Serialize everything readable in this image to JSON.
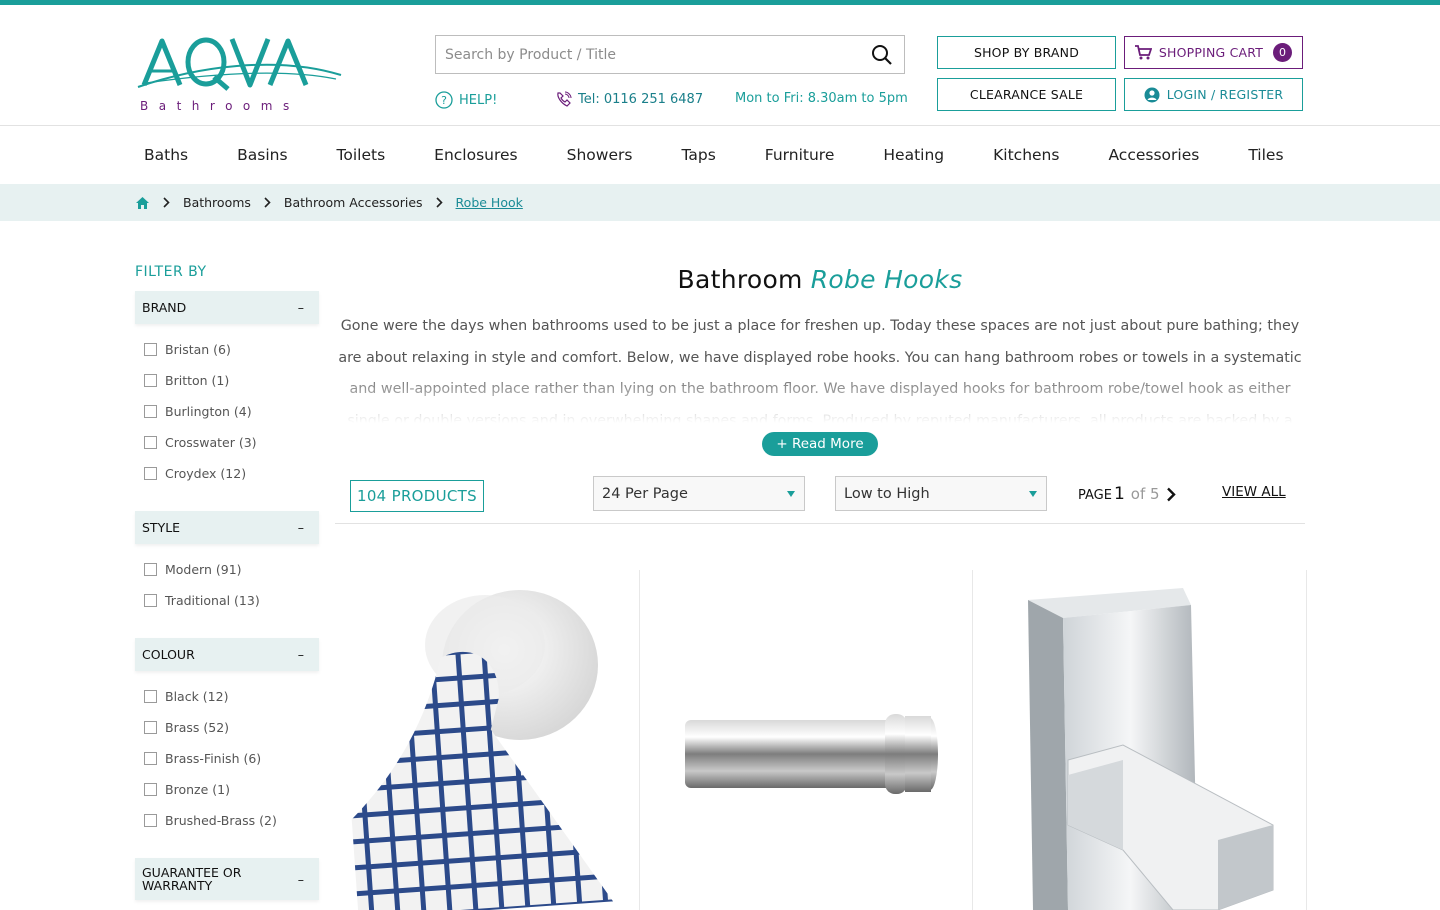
{
  "brand": {
    "name": "AQVA",
    "tagline": "Bathrooms"
  },
  "search": {
    "placeholder": "Search by Product / Title"
  },
  "contact": {
    "help": "HELP!",
    "tel": "Tel: 0116 251 6487",
    "hours": "Mon to Fri: 8.30am to 5pm"
  },
  "header_buttons": {
    "shop_by_brand": "SHOP BY BRAND",
    "shopping_cart": "SHOPPING CART",
    "cart_count": "0",
    "clearance_sale": "CLEARANCE SALE",
    "login": "LOGIN / REGISTER"
  },
  "nav": [
    "Baths",
    "Basins",
    "Toilets",
    "Enclosures",
    "Showers",
    "Taps",
    "Furniture",
    "Heating",
    "Kitchens",
    "Accessories",
    "Tiles"
  ],
  "breadcrumb": [
    "Bathrooms",
    "Bathroom Accessories",
    "Robe Hook"
  ],
  "filters": {
    "title": "FILTER BY",
    "groups": [
      {
        "name": "BRAND",
        "toggle": "–",
        "options": [
          "Bristan (6)",
          "Britton (1)",
          "Burlington (4)",
          "Crosswater (3)",
          "Croydex (12)"
        ]
      },
      {
        "name": "STYLE",
        "toggle": "–",
        "options": [
          "Modern (91)",
          "Traditional (13)"
        ]
      },
      {
        "name": "COLOUR",
        "toggle": "–",
        "options": [
          "Black (12)",
          "Brass (52)",
          "Brass-Finish (6)",
          "Bronze (1)",
          "Brushed-Brass (2)"
        ]
      },
      {
        "name": "GUARANTEE OR WARRANTY",
        "toggle": "–",
        "options": []
      }
    ]
  },
  "page": {
    "title_prefix": "Bathroom",
    "title_em": "Robe Hooks",
    "description": "Gone were the days when bathrooms used to be just a place for freshen up. Today these spaces are not just about pure bathing; they are about relaxing in style and comfort. Below, we have displayed robe hooks. You can hang bathroom robes or towels in a systematic and well-appointed place rather than lying on the bathroom floor. We have displayed hooks for bathroom robe/towel hook as either single or double versions and in overwhelming shapes and forms. Produced by reputed manufacturers, all products are backed by a",
    "read_more": "+  Read More",
    "product_count": "104 PRODUCTS",
    "per_page": "24 Per Page",
    "sort": "Low to High",
    "page_label": "PAGE",
    "page_current": "1",
    "page_of": "of 5",
    "view_all": "VIEW ALL"
  },
  "colors": {
    "accent": "#1a9e9a",
    "purple": "#6b1d7a",
    "breadcrumb_bg": "#e7f1f1"
  }
}
